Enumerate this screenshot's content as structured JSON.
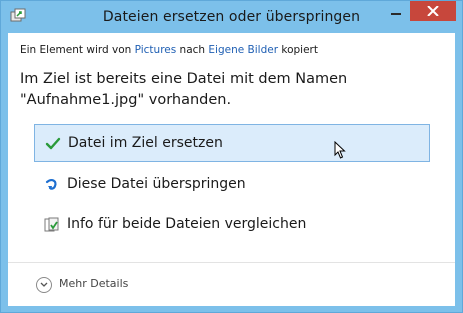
{
  "window": {
    "title": "Dateien ersetzen oder überspringen"
  },
  "info": {
    "prefix": "Ein Element wird von ",
    "source": "Pictures",
    "middle": " nach ",
    "destination": "Eigene Bilder",
    "suffix": " kopiert"
  },
  "message": {
    "line1": "Im Ziel ist bereits eine Datei mit dem Namen",
    "line2": "\"Aufnahme1.jpg\" vorhanden."
  },
  "options": [
    {
      "label": "Datei im Ziel ersetzen",
      "icon": "checkmark-icon",
      "selected": true
    },
    {
      "label": "Diese Datei überspringen",
      "icon": "skip-arrow-icon",
      "selected": false
    },
    {
      "label": "Info für beide Dateien vergleichen",
      "icon": "compare-files-icon",
      "selected": false
    }
  ],
  "footer": {
    "more_details_label": "Mehr Details",
    "icon": "chevron-down-icon"
  },
  "colors": {
    "titlebar": "#7cc0ea",
    "close_button": "#c7473c",
    "link": "#1f5fb3",
    "selection": "#dbecfb"
  }
}
